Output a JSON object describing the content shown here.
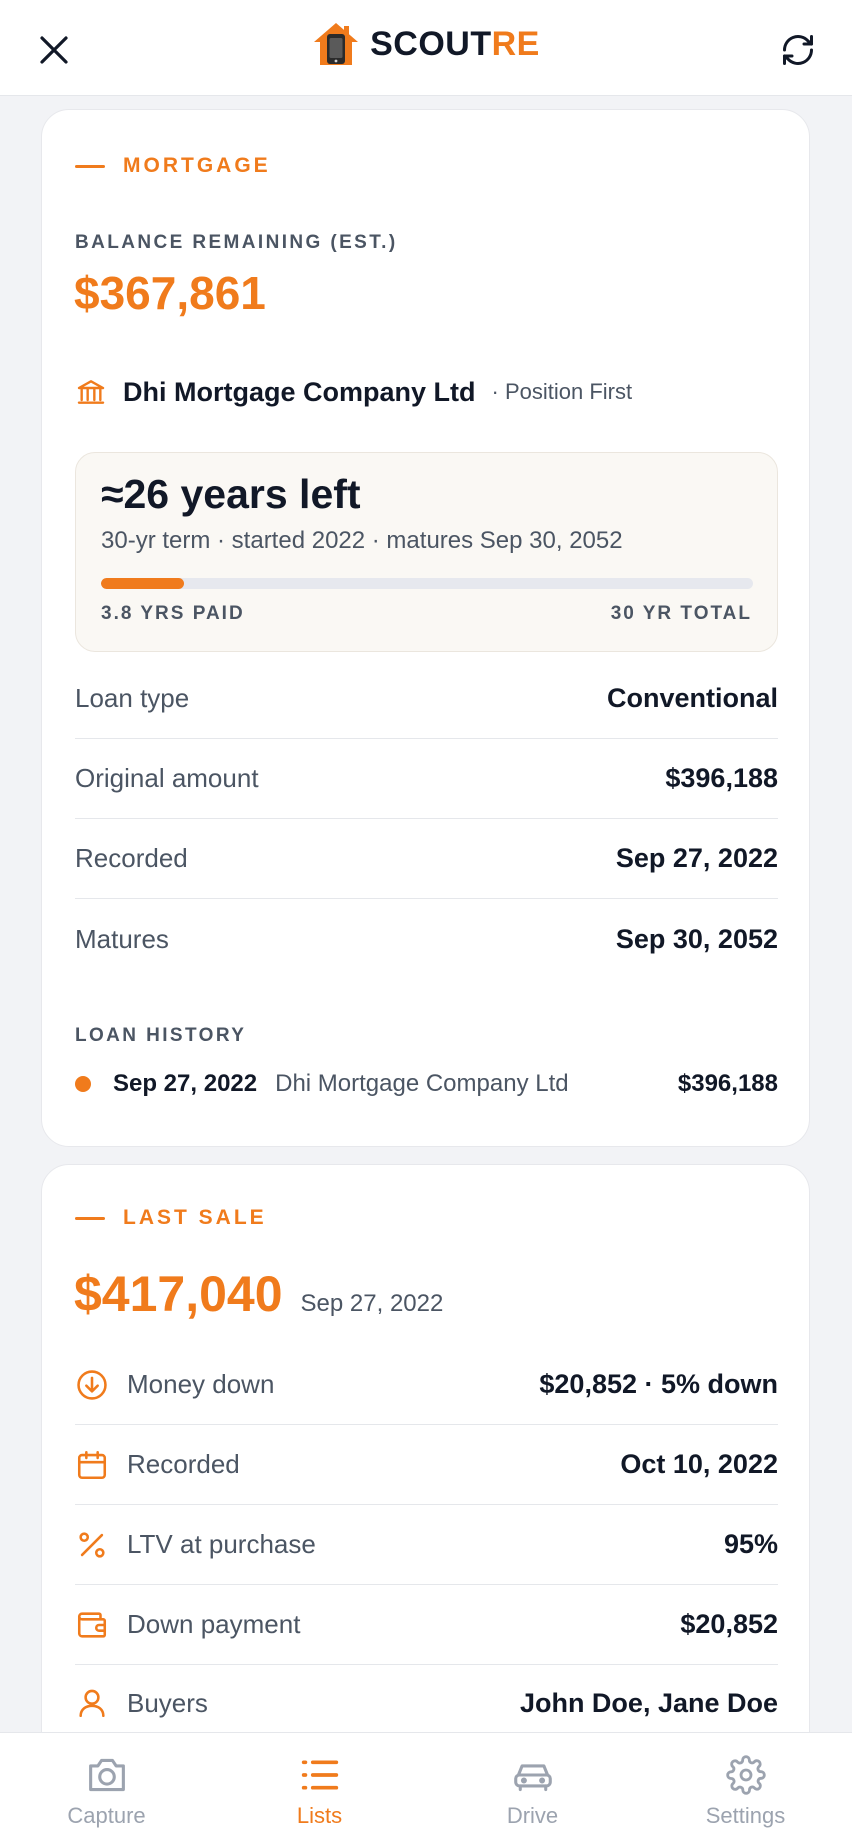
{
  "header": {
    "brand_prefix": "SCOUT",
    "brand_suffix": "RE"
  },
  "mortgage": {
    "section_title": "MORTGAGE",
    "balance_label": "BALANCE REMAINING (EST.)",
    "balance_value": "$367,861",
    "lender_name": "Dhi Mortgage Company Ltd",
    "lender_position": "· Position First",
    "term_title": "≈26 years left",
    "term_subtitle": "30-yr term · started 2022 · matures Sep 30, 2052",
    "progress_fraction": 0.127,
    "progress_left_label": "3.8 YRS PAID",
    "progress_right_label": "30 YR TOTAL",
    "details": [
      {
        "label": "Loan type",
        "value": "Conventional"
      },
      {
        "label": "Original amount",
        "value": "$396,188"
      },
      {
        "label": "Recorded",
        "value": "Sep 27, 2022"
      },
      {
        "label": "Matures",
        "value": "Sep 30, 2052"
      }
    ],
    "history_label": "LOAN HISTORY",
    "history": [
      {
        "date": "Sep 27, 2022",
        "lender": "Dhi Mortgage Company Ltd",
        "amount": "$396,188"
      }
    ]
  },
  "last_sale": {
    "section_title": "LAST SALE",
    "price": "$417,040",
    "date": "Sep 27, 2022",
    "details": [
      {
        "icon": "arrow-down-circle-icon",
        "label": "Money down",
        "value": "$20,852 · 5% down"
      },
      {
        "icon": "calendar-icon",
        "label": "Recorded",
        "value": "Oct 10, 2022"
      },
      {
        "icon": "percent-icon",
        "label": "LTV at purchase",
        "value": "95%"
      },
      {
        "icon": "wallet-icon",
        "label": "Down payment",
        "value": "$20,852"
      },
      {
        "icon": "user-icon",
        "label": "Buyers",
        "value": "John Doe, Jane Doe"
      }
    ]
  },
  "tabs": [
    {
      "label": "Capture",
      "icon": "camera-icon",
      "active": false
    },
    {
      "label": "Lists",
      "icon": "list-icon",
      "active": true
    },
    {
      "label": "Drive",
      "icon": "car-icon",
      "active": false
    },
    {
      "label": "Settings",
      "icon": "gear-icon",
      "active": false
    }
  ],
  "colors": {
    "accent": "#f07b1c",
    "text_primary": "#111827",
    "text_secondary": "#4b5563",
    "tab_inactive": "#9ca3af"
  }
}
